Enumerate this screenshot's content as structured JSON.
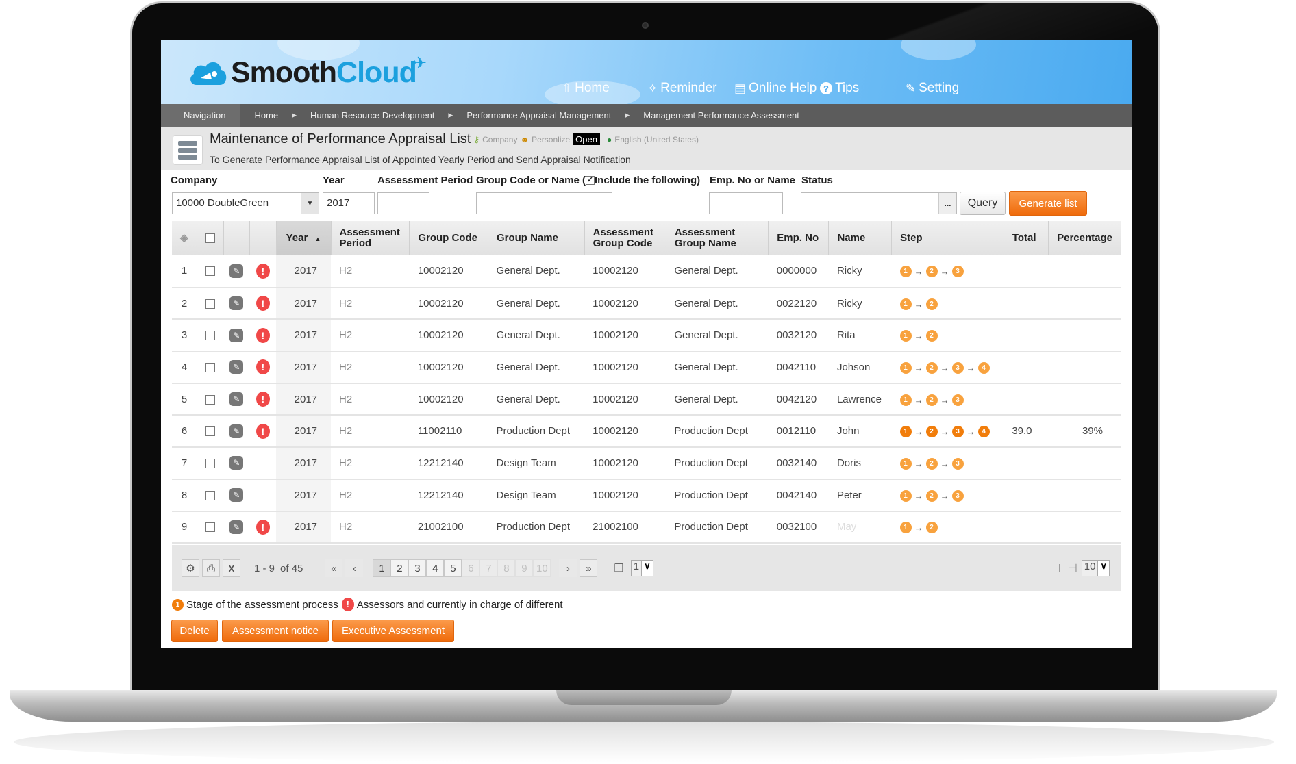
{
  "app": {
    "logo_part1": "Smooth",
    "logo_part2": "Cloud"
  },
  "nav": [
    {
      "icon": "home-icon",
      "glyph": "⇧",
      "label": "Home"
    },
    {
      "icon": "bell-icon",
      "glyph": "✧",
      "label": "Reminder"
    },
    {
      "icon": "document-icon",
      "glyph": "▤",
      "label": "Online Help"
    },
    {
      "icon": "question-icon",
      "glyph": "?",
      "label": "Tips"
    },
    {
      "icon": "wrench-icon",
      "glyph": "✎",
      "label": "Setting"
    }
  ],
  "breadcrumb": {
    "label": "Navigation",
    "items": [
      "Home",
      "Human Resource Development",
      "Performance Appraisal Management",
      "Management Performance Assessment"
    ]
  },
  "page": {
    "title": "Maintenance of Performance Appraisal List",
    "company_label": "Company",
    "personalize_label": "Personlize",
    "open_label": "Open",
    "language": "English (United States)",
    "subtitle": "To Generate Performance Appraisal List of Appointed Yearly Period and Send Appraisal Notification"
  },
  "filters": {
    "company_label": "Company",
    "company_value": "10000 DoubleGreen",
    "year_label": "Year",
    "year_value": "2017",
    "period_label": "Assessment Period",
    "period_value": "",
    "group_label": "Group Code or Name (",
    "include_label": "Include the following)",
    "include_checked": true,
    "group_value": "",
    "emp_label": "Emp. No or Name",
    "emp_value": "",
    "status_label": "Status",
    "status_value": "",
    "ellipsis_label": "...",
    "query_label": "Query",
    "generate_label": "Generate list"
  },
  "table": {
    "columns": [
      "Year",
      "Assessment Period",
      "Group Code",
      "Group Name",
      "Assessment Group Code",
      "Assessment Group Name",
      "Emp. No",
      "Name",
      "Step",
      "Total",
      "Percentage"
    ],
    "sorted_column": "Year",
    "sort_direction": "ascending",
    "rows": [
      {
        "no": "1",
        "warn": true,
        "year": "2017",
        "period": "H2",
        "group_code": "10002120",
        "group_name": "General Dept.",
        "a_group_code": "10002120",
        "a_group_name": "General Dept.",
        "emp_no": "0000000",
        "name": "Ricky",
        "steps": 3,
        "current_step_highlight": false,
        "total": "",
        "percentage": ""
      },
      {
        "no": "2",
        "warn": true,
        "year": "2017",
        "period": "H2",
        "group_code": "10002120",
        "group_name": "General Dept.",
        "a_group_code": "10002120",
        "a_group_name": "General Dept.",
        "emp_no": "0022120",
        "name": "Ricky",
        "steps": 2,
        "current_step_highlight": false,
        "total": "",
        "percentage": ""
      },
      {
        "no": "3",
        "warn": true,
        "year": "2017",
        "period": "H2",
        "group_code": "10002120",
        "group_name": "General Dept.",
        "a_group_code": "10002120",
        "a_group_name": "General Dept.",
        "emp_no": "0032120",
        "name": "Rita",
        "steps": 2,
        "current_step_highlight": false,
        "total": "",
        "percentage": ""
      },
      {
        "no": "4",
        "warn": true,
        "year": "2017",
        "period": "H2",
        "group_code": "10002120",
        "group_name": "General Dept.",
        "a_group_code": "10002120",
        "a_group_name": "General Dept.",
        "emp_no": "0042110",
        "name": "Johson",
        "steps": 4,
        "current_step_highlight": false,
        "total": "",
        "percentage": ""
      },
      {
        "no": "5",
        "warn": true,
        "year": "2017",
        "period": "H2",
        "group_code": "10002120",
        "group_name": "General Dept.",
        "a_group_code": "10002120",
        "a_group_name": "General Dept.",
        "emp_no": "0042120",
        "name": "Lawrence",
        "steps": 3,
        "current_step_highlight": false,
        "total": "",
        "percentage": ""
      },
      {
        "no": "6",
        "warn": true,
        "year": "2017",
        "period": "H2",
        "group_code": "11002110",
        "group_name": "Production Dept",
        "a_group_code": "10002120",
        "a_group_name": "Production Dept",
        "emp_no": "0012110",
        "name": "John",
        "steps": 4,
        "current_step_highlight": true,
        "total": "39.0",
        "percentage": "39%"
      },
      {
        "no": "7",
        "warn": false,
        "year": "2017",
        "period": "H2",
        "group_code": "12212140",
        "group_name": "Design Team",
        "a_group_code": "10002120",
        "a_group_name": "Production Dept",
        "emp_no": "0032140",
        "name": "Doris",
        "steps": 3,
        "current_step_highlight": false,
        "total": "",
        "percentage": ""
      },
      {
        "no": "8",
        "warn": false,
        "year": "2017",
        "period": "H2",
        "group_code": "12212140",
        "group_name": "Design Team",
        "a_group_code": "10002120",
        "a_group_name": "Production Dept",
        "emp_no": "0042140",
        "name": "Peter",
        "steps": 3,
        "current_step_highlight": false,
        "total": "",
        "percentage": ""
      },
      {
        "no": "9",
        "warn": true,
        "year": "2017",
        "period": "H2",
        "group_code": "21002100",
        "group_name": "Production Dept",
        "a_group_code": "21002100",
        "a_group_name": "Production Dept",
        "emp_no": "0032100",
        "name": "May",
        "name_faded": true,
        "steps": 2,
        "current_step_highlight": false,
        "total": "",
        "percentage": ""
      }
    ]
  },
  "pager": {
    "range_text": "1 - 9",
    "of_text": "of 45",
    "pages": [
      "1",
      "2",
      "3",
      "4",
      "5",
      "6",
      "7",
      "8",
      "9",
      "10"
    ],
    "current_page": "1",
    "enabled_pages": 5,
    "goto_value": "1",
    "page_size": "10"
  },
  "legend": {
    "stage_number": "1",
    "stage_text": "Stage of the assessment process",
    "warn_text": "Assessors and currently in charge of different"
  },
  "actions": {
    "delete": "Delete",
    "notice": "Assessment notice",
    "execute": "Executive Assessment"
  },
  "colors": {
    "accent_orange": "#f17d0b",
    "step_orange": "#f8a23e",
    "warn_red": "#f04848",
    "header_blue": "#6cbcf5",
    "breadcrumb_bg": "#5c5c5c"
  }
}
